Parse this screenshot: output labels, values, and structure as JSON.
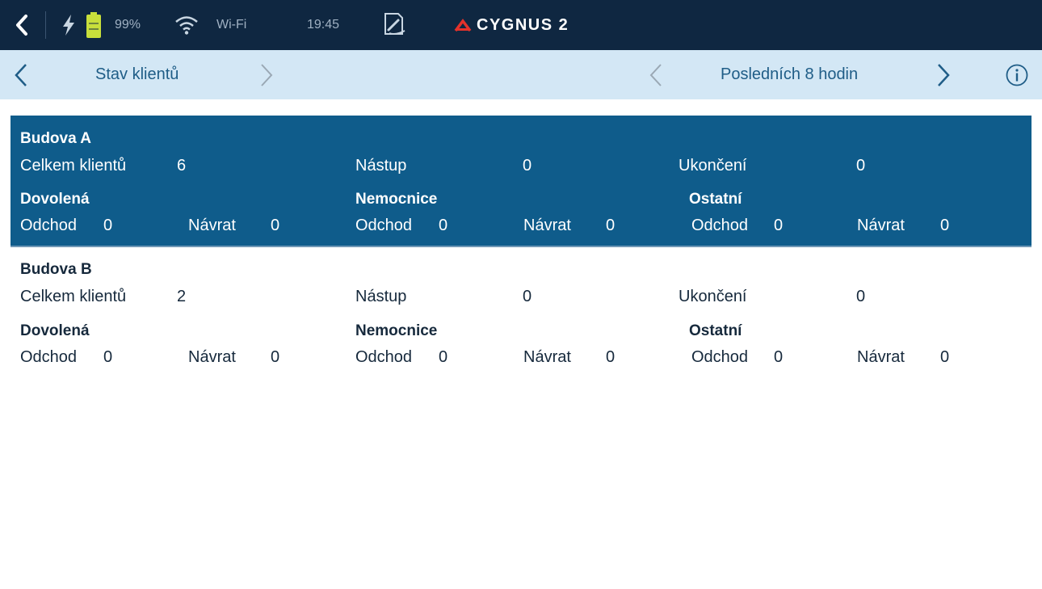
{
  "status_bar": {
    "battery_percent": "99%",
    "wifi_label": "Wi-Fi",
    "time": "19:45",
    "logo_text": "CYGNUS 2",
    "colors": {
      "background": "#0f2741",
      "battery": "#c8df3b",
      "logo_accent": "#e4322b"
    }
  },
  "nav": {
    "screen_title": "Stav klientů",
    "period_title": "Posledních 8 hodin"
  },
  "buildings": [
    {
      "name": "Budova A",
      "selected": true,
      "celkem_label": "Celkem klientů",
      "celkem_value": "6",
      "nastup_label": "Nástup",
      "nastup_value": "0",
      "ukonceni_label": "Ukončení",
      "ukonceni_value": "0",
      "groups": [
        {
          "title": "Dovolená",
          "odchod_label": "Odchod",
          "odchod_value": "0",
          "navrat_label": "Návrat",
          "navrat_value": "0"
        },
        {
          "title": "Nemocnice",
          "odchod_label": "Odchod",
          "odchod_value": "0",
          "navrat_label": "Návrat",
          "navrat_value": "0"
        },
        {
          "title": "Ostatní",
          "odchod_label": "Odchod",
          "odchod_value": "0",
          "navrat_label": "Návrat",
          "navrat_value": "0"
        }
      ]
    },
    {
      "name": "Budova B",
      "selected": false,
      "celkem_label": "Celkem klientů",
      "celkem_value": "2",
      "nastup_label": "Nástup",
      "nastup_value": "0",
      "ukonceni_label": "Ukončení",
      "ukonceni_value": "0",
      "groups": [
        {
          "title": "Dovolená",
          "odchod_label": "Odchod",
          "odchod_value": "0",
          "navrat_label": "Návrat",
          "navrat_value": "0"
        },
        {
          "title": "Nemocnice",
          "odchod_label": "Odchod",
          "odchod_value": "0",
          "navrat_label": "Návrat",
          "navrat_value": "0"
        },
        {
          "title": "Ostatní",
          "odchod_label": "Odchod",
          "odchod_value": "0",
          "navrat_label": "Návrat",
          "navrat_value": "0"
        }
      ]
    }
  ],
  "icons": {
    "back": "back-arrow-icon",
    "bolt": "charging-bolt-icon",
    "battery": "battery-icon",
    "wifi": "wifi-icon",
    "sign": "sign-document-icon",
    "info": "info-icon"
  }
}
